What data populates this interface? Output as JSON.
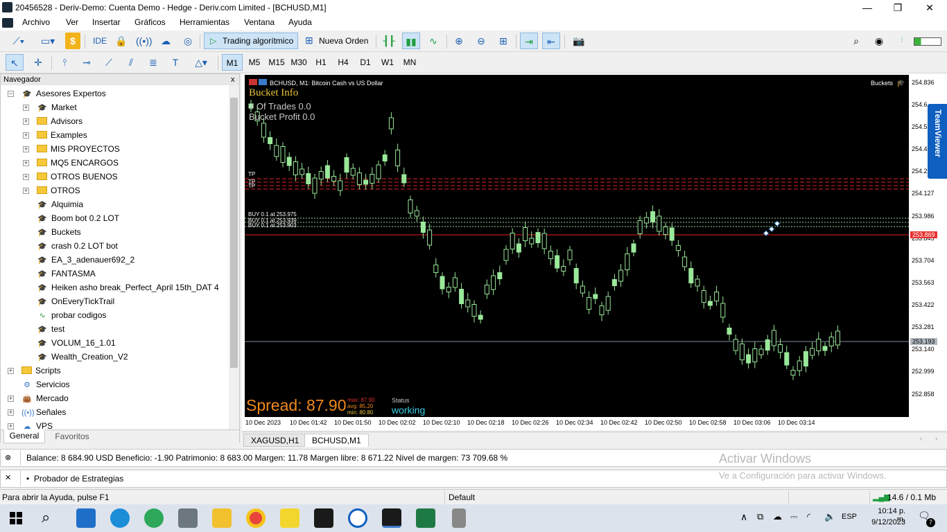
{
  "window": {
    "title": "20456528 - Deriv-Demo: Cuenta Demo - Hedge - Deriv.com Limited - [BCHUSD,M1]",
    "minimize": "—",
    "maximize": "❐",
    "close": "✕"
  },
  "menu": [
    "Archivo",
    "Ver",
    "Insertar",
    "Gráficos",
    "Herramientas",
    "Ventana",
    "Ayuda"
  ],
  "toolbar1": {
    "ide": "IDE",
    "algo": "Trading algorítmico",
    "order": "Nueva Orden"
  },
  "timeframes": [
    "M1",
    "M5",
    "M15",
    "M30",
    "H1",
    "H4",
    "D1",
    "W1",
    "MN"
  ],
  "navigator": {
    "title": "Navegador",
    "close": "x",
    "root": "Asesores Expertos",
    "items": [
      "Market",
      "Advisors",
      "Examples",
      "MIS PROYECTOS",
      "MQ5 ENCARGOS",
      "OTROS BUENOS",
      "OTROS",
      "Alquimia",
      "Boom bot 0.2 LOT",
      "Buckets",
      "crash 0.2 LOT  bot",
      "EA_3_adenauer692_2",
      "FANTASMA",
      "Heiken asho break_Perfect_April 15th_DAT 4",
      "OnEveryTickTrail",
      "probar codigos",
      "test",
      "VOLUM_16_1.01",
      "Wealth_Creation_V2"
    ],
    "others": [
      "Scripts",
      "Servicios",
      "Mercado",
      "Señales",
      "VPS"
    ],
    "tabs": [
      "General",
      "Favoritos"
    ]
  },
  "chart": {
    "symbol": "BCHUSD, M1:  Bitcoin Cash vs US Dollar",
    "ea": "Buckets",
    "bucket_title": "Bucket Info",
    "trades": "# Of Trades 0.0",
    "profit": "Bucket Profit 0.0",
    "spread": "Spread: 87.90",
    "max": "max: 87.90",
    "avg": "avg: 85.20",
    "min": "min: 80.80",
    "status_label": "Status",
    "status_val": "working",
    "buy1": "BUY 0.1 at 253.975",
    "buy2": "BUY 0.1 at 253.939",
    "buy3": "BUY 0.1 at 253.903",
    "tp": "TP",
    "ask": "253.869",
    "bid": "253.193",
    "y_ticks": [
      "254.836",
      "254.6",
      "254.5",
      "254.4",
      "254.2",
      "254.127",
      "253.986",
      "253.845",
      "253.704",
      "253.563",
      "253.422",
      "253.281",
      "253.140",
      "252.999",
      "252.858"
    ],
    "x_ticks": [
      "10 Dec 2023",
      "10 Dec 01:42",
      "10 Dec 01:50",
      "10 Dec 02:02",
      "10 Dec 02:10",
      "10 Dec 02:18",
      "10 Dec 02:26",
      "10 Dec 02:34",
      "10 Dec 02:42",
      "10 Dec 02:50",
      "10 Dec 02:58",
      "10 Dec 03:06",
      "10 Dec 03:14"
    ]
  },
  "chart_tabs": [
    "XAGUSD,H1",
    "BCHUSD,M1"
  ],
  "balance_text": "Balance: 8 684.90 USD  Beneficio: -1.90  Patrimonio: 8 683.00  Margen: 11.78  Margen libre: 8 671.22  Nivel de margen: 73 709.68 %",
  "tester": "Probador de Estrategias",
  "activate": {
    "title": "Activar Windows",
    "sub": "Ve a Configuración para activar Windows."
  },
  "statusbar": {
    "help": "Para abrir la Ayuda, pulse F1",
    "profile": "Default",
    "net": "14.6 / 0.1 Mb"
  },
  "taskbar": {
    "lang": "ESP",
    "time": "10:14 p. m.",
    "date": "9/12/2023",
    "notif": "7"
  },
  "teamviewer": "TeamViewer"
}
